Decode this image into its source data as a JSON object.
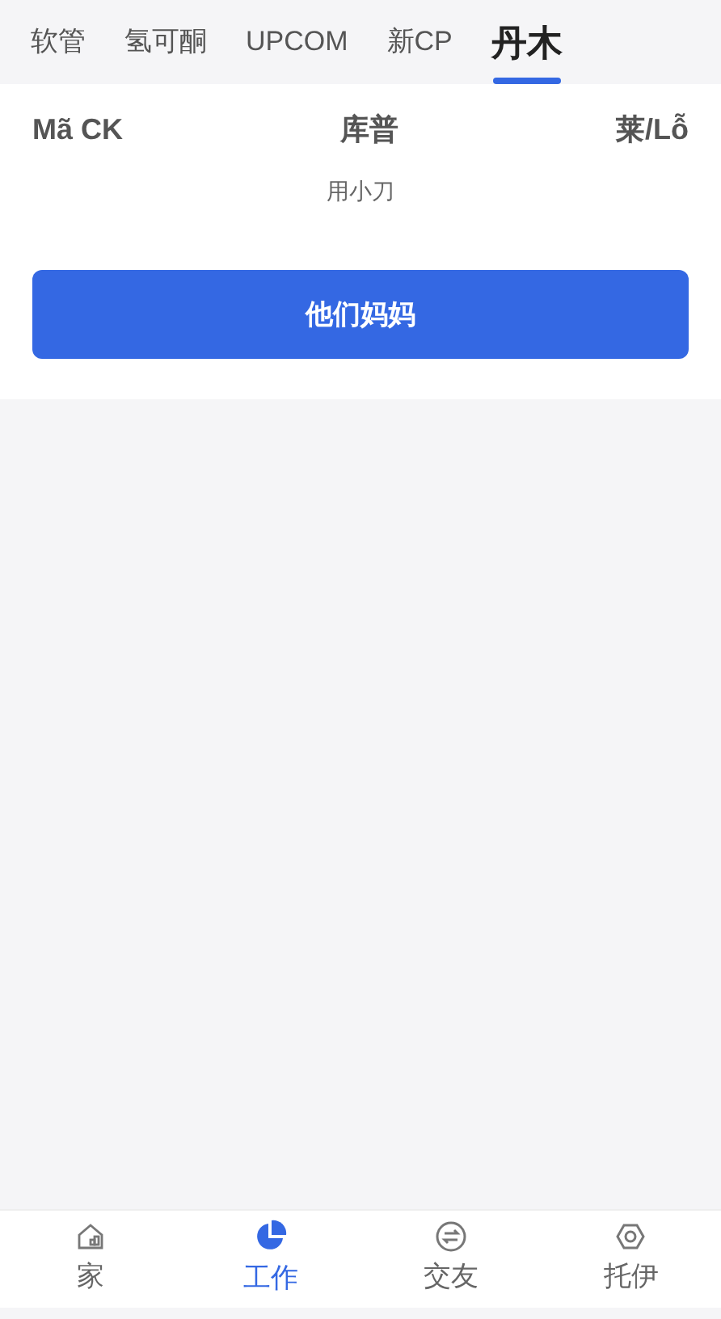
{
  "tabs": [
    {
      "label": "软管",
      "selected": false
    },
    {
      "label": "氢可酮",
      "selected": false
    },
    {
      "label": "UPCOM",
      "selected": false
    },
    {
      "label": "新CP",
      "selected": false
    },
    {
      "label": "丹木",
      "selected": true
    }
  ],
  "table": {
    "columns": [
      "Mã CK",
      "库普",
      "莱/Lỗ"
    ],
    "empty_message": "用小刀"
  },
  "action_button": "他们妈妈",
  "bottom_nav": [
    {
      "label": "家",
      "kind": "home",
      "selected": false
    },
    {
      "label": "工作",
      "kind": "pie",
      "selected": true
    },
    {
      "label": "交友",
      "kind": "exchange",
      "selected": false
    },
    {
      "label": "托伊",
      "kind": "settings",
      "selected": false
    }
  ]
}
